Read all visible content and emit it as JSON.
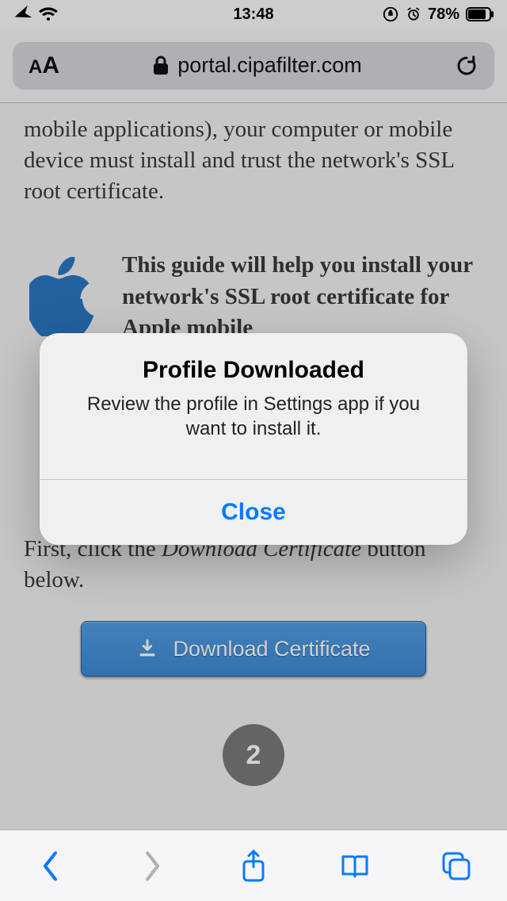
{
  "status": {
    "time": "13:48",
    "battery": "78%"
  },
  "browser": {
    "domain_text": "portal.cipafilter.com"
  },
  "page": {
    "para1": "mobile applications), your computer or mobile device must install and trust the network's SSL root certificate.",
    "guide_bold": "This guide will help you install your network's SSL root certificate for Apple mobile",
    "para2_a": "First, click the ",
    "para2_ital": "Download Certificate",
    "para2_b": " button below.",
    "download_button": "Download Certificate",
    "step_badge": "2"
  },
  "alert": {
    "title": "Profile Downloaded",
    "message": "Review the profile in Settings app if you want to install it.",
    "close_label": "Close"
  },
  "colors": {
    "link_blue": "#0a7aff",
    "button_blue": "#3e89d6",
    "apple_blue": "#2a78c2",
    "disabled_grey": "#b0b0b4"
  }
}
